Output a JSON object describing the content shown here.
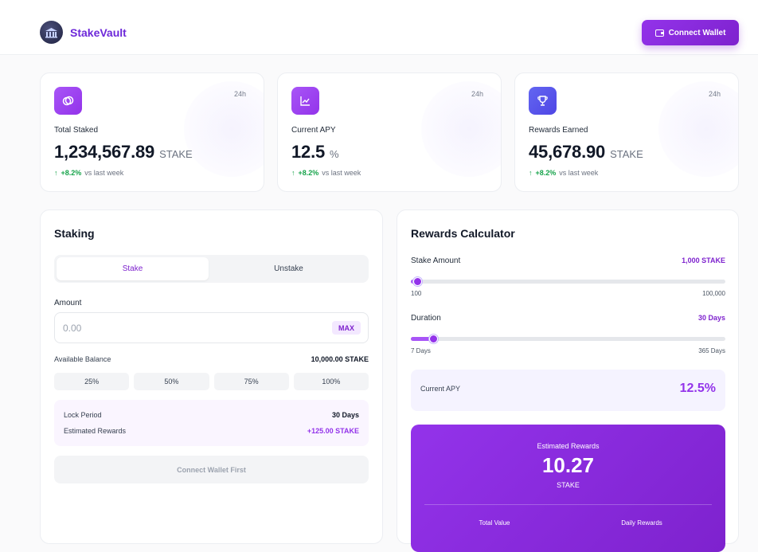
{
  "header": {
    "brand_name": "StakeVault",
    "connect_label": "Connect Wallet"
  },
  "stats": [
    {
      "icon": "coins-icon",
      "label": "Total Staked",
      "value": "1,234,567.89",
      "unit": "STAKE",
      "period": "24h",
      "change": "+8.2%",
      "change_note": "vs last week"
    },
    {
      "icon": "chart-line-icon",
      "label": "Current APY",
      "value": "12.5",
      "unit": "%",
      "period": "24h",
      "change": "+8.2%",
      "change_note": "vs last week"
    },
    {
      "icon": "trophy-icon",
      "label": "Rewards Earned",
      "value": "45,678.90",
      "unit": "STAKE",
      "period": "24h",
      "change": "+8.2%",
      "change_note": "vs last week"
    }
  ],
  "staking": {
    "title": "Staking",
    "tabs": [
      {
        "label": "Stake",
        "active": true
      },
      {
        "label": "Unstake",
        "active": false
      }
    ],
    "amount_label": "Amount",
    "amount_placeholder": "0.00",
    "max_label": "MAX",
    "balance_label": "Available Balance",
    "balance_value": "10,000.00 STAKE",
    "percent_buttons": [
      "25%",
      "50%",
      "75%",
      "100%"
    ],
    "lock_period_label": "Lock Period",
    "lock_period_value": "30 Days",
    "est_rewards_label": "Estimated Rewards",
    "est_rewards_value": "+125.00 STAKE",
    "submit_label": "Connect Wallet First"
  },
  "calculator": {
    "title": "Rewards Calculator",
    "stake_amount_label": "Stake Amount",
    "stake_amount_value": "1,000 STAKE",
    "stake_min": "100",
    "stake_max": "100,000",
    "stake_level": 0.02,
    "duration_label": "Duration",
    "duration_value": "30 Days",
    "duration_min": "7 Days",
    "duration_max": "365 Days",
    "duration_level": 0.07,
    "apy_label": "Current APY",
    "apy_value": "12.5%",
    "rewards_title": "Estimated Rewards",
    "rewards_value": "10.27",
    "rewards_unit": "STAKE",
    "total_value_label": "Total Value",
    "daily_rewards_label": "Daily Rewards"
  },
  "colors": {
    "accent": "#9333ea",
    "positive": "#16a34a"
  }
}
